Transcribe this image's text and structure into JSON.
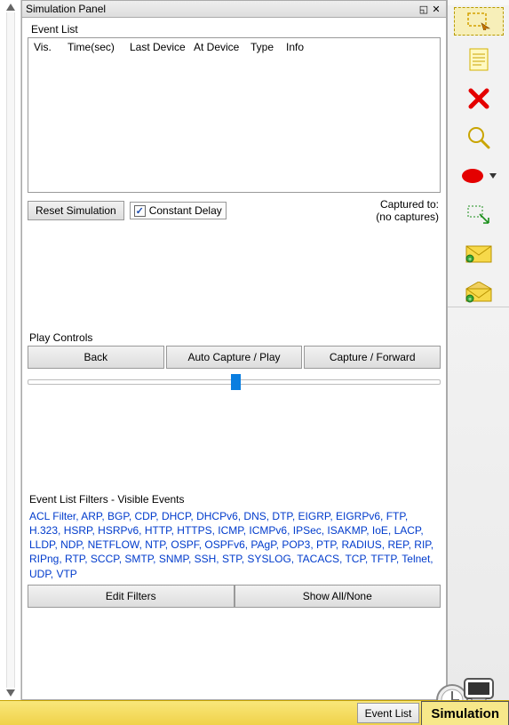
{
  "panel": {
    "title": "Simulation Panel"
  },
  "eventList": {
    "label": "Event List",
    "columns": {
      "vis": "Vis.",
      "time": "Time(sec)",
      "last": "Last Device",
      "at": "At Device",
      "type": "Type",
      "info": "Info"
    },
    "rows": []
  },
  "reset": {
    "button": "Reset Simulation",
    "constantDelay": "Constant Delay"
  },
  "capture": {
    "line1": "Captured to:",
    "line2": "(no captures)"
  },
  "playControls": {
    "label": "Play Controls",
    "back": "Back",
    "auto": "Auto Capture / Play",
    "forward": "Capture / Forward"
  },
  "filters": {
    "label": "Event List Filters - Visible Events",
    "text": "ACL Filter, ARP, BGP, CDP, DHCP, DHCPv6, DNS, DTP, EIGRP, EIGRPv6, FTP, H.323, HSRP, HSRPv6, HTTP, HTTPS, ICMP, ICMPv6, IPSec, ISAKMP, IoE, LACP, LLDP, NDP, NETFLOW, NTP, OSPF, OSPFv6, PAgP, POP3, PTP, RADIUS, REP, RIP, RIPng, RTP, SCCP, SMTP, SNMP, SSH, STP, SYSLOG, TACACS, TCP, TFTP, Telnet, UDP, VTP",
    "edit": "Edit Filters",
    "showAll": "Show All/None"
  },
  "footer": {
    "eventList": "Event List",
    "simulation": "Simulation"
  },
  "toolbar": {
    "tools": [
      "select-area",
      "note",
      "delete",
      "inspect",
      "shape",
      "resize",
      "add-simple-pdu",
      "add-complex-pdu"
    ]
  }
}
